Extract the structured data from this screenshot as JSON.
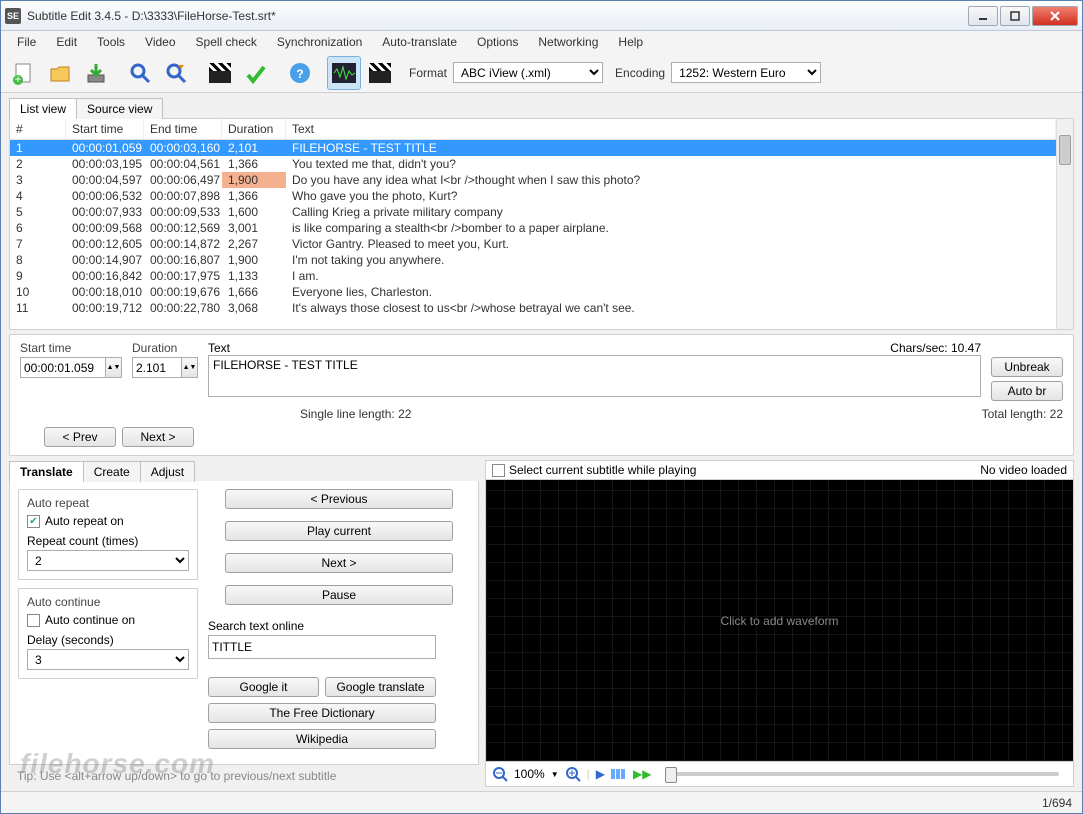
{
  "titlebar": {
    "title": "Subtitle Edit 3.4.5 - D:\\3333\\FileHorse-Test.srt*"
  },
  "menu": [
    "File",
    "Edit",
    "Tools",
    "Video",
    "Spell check",
    "Synchronization",
    "Auto-translate",
    "Options",
    "Networking",
    "Help"
  ],
  "toolbar": {
    "format_label": "Format",
    "format_value": "ABC iView (.xml)",
    "encoding_label": "Encoding",
    "encoding_value": "1252: Western Euro"
  },
  "tabs": {
    "list": "List view",
    "source": "Source view"
  },
  "columns": {
    "num": "#",
    "start": "Start time",
    "end": "End time",
    "dur": "Duration",
    "text": "Text"
  },
  "rows": [
    {
      "n": "1",
      "s": "00:00:01,059",
      "e": "00:00:03,160",
      "d": "2,101",
      "t": "FILEHORSE - TEST TITLE",
      "sel": true
    },
    {
      "n": "2",
      "s": "00:00:03,195",
      "e": "00:00:04,561",
      "d": "1,366",
      "t": "You texted me that, didn't you?"
    },
    {
      "n": "3",
      "s": "00:00:04,597",
      "e": "00:00:06,497",
      "d": "1,900",
      "t": "Do you have any idea what I<br />thought when I saw this photo?",
      "dh": true
    },
    {
      "n": "4",
      "s": "00:00:06,532",
      "e": "00:00:07,898",
      "d": "1,366",
      "t": "Who gave you the photo, Kurt?"
    },
    {
      "n": "5",
      "s": "00:00:07,933",
      "e": "00:00:09,533",
      "d": "1,600",
      "t": "Calling Krieg a private military company"
    },
    {
      "n": "6",
      "s": "00:00:09,568",
      "e": "00:00:12,569",
      "d": "3,001",
      "t": "is like comparing a stealth<br />bomber to a paper airplane."
    },
    {
      "n": "7",
      "s": "00:00:12,605",
      "e": "00:00:14,872",
      "d": "2,267",
      "t": "Victor Gantry. Pleased to meet you, Kurt."
    },
    {
      "n": "8",
      "s": "00:00:14,907",
      "e": "00:00:16,807",
      "d": "1,900",
      "t": "I'm not taking you anywhere."
    },
    {
      "n": "9",
      "s": "00:00:16,842",
      "e": "00:00:17,975",
      "d": "1,133",
      "t": "I am."
    },
    {
      "n": "10",
      "s": "00:00:18,010",
      "e": "00:00:19,676",
      "d": "1,666",
      "t": "Everyone lies, Charleston."
    },
    {
      "n": "11",
      "s": "00:00:19,712",
      "e": "00:00:22,780",
      "d": "3,068",
      "t": "It's always those closest to us<br />whose betrayal we can't see."
    }
  ],
  "edit": {
    "start_label": "Start time",
    "start_value": "00:00:01.059",
    "dur_label": "Duration",
    "dur_value": "2.101",
    "text_label": "Text",
    "text_value": "FILEHORSE - TEST TITLE",
    "cps_label": "Chars/sec: 10.47",
    "unbreak": "Unbreak",
    "autobr": "Auto br",
    "line_len": "Single line length: 22",
    "total_len": "Total length: 22",
    "prev": "< Prev",
    "next": "Next >"
  },
  "bottom_tabs": {
    "translate": "Translate",
    "create": "Create",
    "adjust": "Adjust"
  },
  "translate": {
    "autorepeat_group": "Auto repeat",
    "autorepeat_on": "Auto repeat on",
    "repeat_count_label": "Repeat count (times)",
    "repeat_count_value": "2",
    "autocontinue_group": "Auto continue",
    "autocontinue_on": "Auto continue on",
    "delay_label": "Delay (seconds)",
    "delay_value": "3",
    "prev": "< Previous",
    "play": "Play current",
    "next": "Next >",
    "pause": "Pause",
    "search_label": "Search text online",
    "search_value": "TITTLE",
    "google_it": "Google it",
    "google_translate": "Google translate",
    "free_dict": "The Free Dictionary",
    "wikipedia": "Wikipedia",
    "tip": "Tip: Use <alt+arrow up/down> to go to previous/next subtitle"
  },
  "video": {
    "select_while_playing": "Select current subtitle while playing",
    "no_video": "No video loaded",
    "waveform_hint": "Click to add waveform",
    "zoom": "100%"
  },
  "status": {
    "counter": "1/694"
  },
  "watermark": "filehorse.com"
}
